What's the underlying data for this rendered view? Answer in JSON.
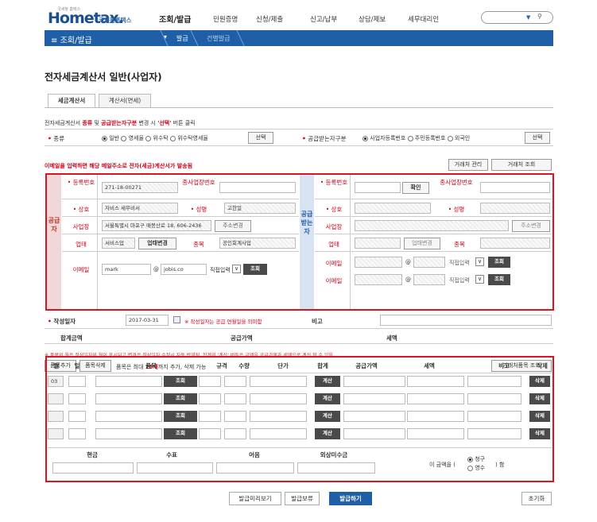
{
  "header": {
    "logo": "Hometax.",
    "logo_small": "국세청 홈택스",
    "logo_kr": "국세청홈택스",
    "nav": [
      "조회/발급",
      "민원증명",
      "신청/제출",
      "신고/납부",
      "상담/제보",
      "세무대리인"
    ]
  },
  "bar": {
    "menu": "≡",
    "title": "조회/발급",
    "step1": "발급",
    "step2": "건별발급"
  },
  "page": {
    "title": "전자세금계산서 일반(사업자)"
  },
  "tabs": [
    "세금계산서",
    "계산서(면세)"
  ],
  "notice": {
    "pre": "전자세금계산서 ",
    "type": "종류",
    "mid": " 및 ",
    "supplier_type": "공급받는자구분",
    "post": " 변경 시 ",
    "select_word": "'선택'",
    "post2": " 버튼 클릭"
  },
  "kind": {
    "label": "종류",
    "options": [
      "일반",
      "영세율",
      "위수탁",
      "위수탁영세율"
    ],
    "select_btn": "선택"
  },
  "recv_type": {
    "label": "공급받는자구분",
    "options": [
      "사업자등록번호",
      "주민등록번호",
      "외국인"
    ],
    "select_btn": "선택"
  },
  "email_notice": "이메일을 입력하면 해당 메일주소로 전자(세금)계산서가 발송됨",
  "client_buttons": [
    "거래처 관리",
    "거래처 조회"
  ],
  "supplier": {
    "side": "공급자",
    "labels": {
      "reg": "등록번호",
      "sub": "종사업장번호",
      "name": "상호",
      "rep": "성명",
      "addr": "사업장",
      "biz": "업태",
      "item": "종목",
      "email": "이메일"
    },
    "reg": "271-18-00271",
    "name": "자비스 세무비서",
    "rep": "고한얼",
    "addr": "서울특별시 마포구 매봉산로 18, 606-2436",
    "addr_btn": "주소변경",
    "biz": "서비스업",
    "biz_btn": "업태변경",
    "item": "공인회계사업",
    "email_id": "mark",
    "email_domain": "jobis.co",
    "email_sel": "직접입력",
    "lookup": "조회"
  },
  "receiver": {
    "side": "공급받는자",
    "confirm_btn": "확인",
    "addr_btn": "주소변경",
    "biz_btn": "업태변경",
    "email_sel": "직접입력",
    "lookup": "조회",
    "at": "@"
  },
  "date": {
    "label": "작성일자",
    "value": "2017-03-31",
    "note": "※ 작성일자는 공급 연월일을 의미함",
    "memo": "비고",
    "total": "합계금액",
    "supply": "공급가액",
    "tax": "세액"
  },
  "items_notice": "※ 품목의 월은 작성일자의 월이 표시되고 변경은 작성일자 수정시 자동 반영됨, 합계의 '계산' 버튼은 금액을 공급가액과 세액으로 계산 할 수 있음",
  "item_buttons": {
    "add": "품목추가",
    "del": "품목삭제",
    "limit_pre": "품목은 최대 ",
    "limit": "16개",
    "limit_post": "까지 추가, 삭제 가능",
    "client_item": "거래처품목 조회"
  },
  "table": {
    "headers": [
      "월",
      "일",
      "품목",
      "규격",
      "수량",
      "단가",
      "합계",
      "공급가액",
      "세액",
      "비고",
      "삭제"
    ],
    "first_month": "03",
    "lookup": "조회",
    "calc": "계산",
    "delete": "삭제"
  },
  "payment": {
    "headers": [
      "현금",
      "수표",
      "어음",
      "외상미수금"
    ],
    "amount_pre": "이 금액을 (",
    "claim": "청구",
    "receipt": "영수",
    "amount_post": ") 함"
  },
  "bottom": {
    "preview": "발급미리보기",
    "hold": "발급보류",
    "issue": "발급하기",
    "reset": "초기화"
  },
  "colors": {
    "accent": "#1f5fa7",
    "alert": "#d9141e"
  }
}
